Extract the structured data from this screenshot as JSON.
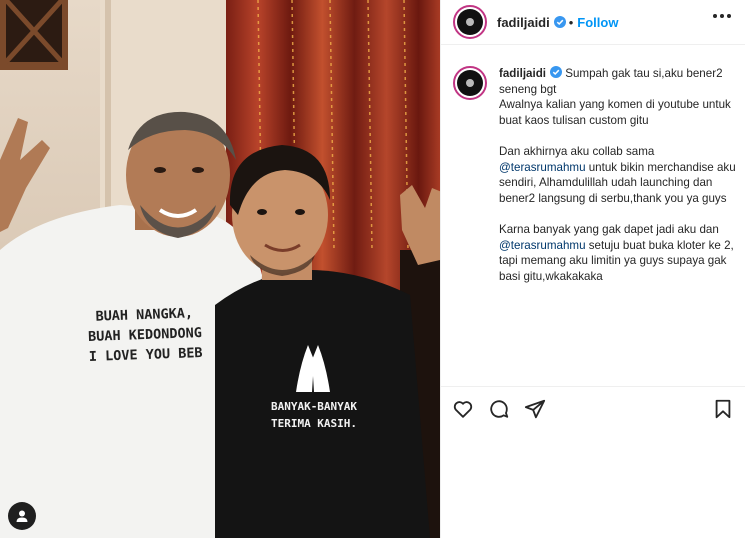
{
  "post": {
    "username": "fadiljaidi",
    "follow_label": "Follow",
    "separator": "•"
  },
  "caption": {
    "username": "fadiljaidi",
    "line1": " Sumpah gak tau si,aku bener2 seneng bgt",
    "line2": "Awalnya kalian yang komen di youtube untuk buat kaos tulisan custom gitu",
    "line3_pre": "Dan akhirnya aku collab sama ",
    "mention1": "@terasrumahmu",
    "line3_post": " untuk bikin merchandise aku sendiri, Alhamdulillah udah launching dan bener2 langsung di serbu,thank you ya guys",
    "line4_pre": "Karna banyak yang gak dapet jadi aku dan ",
    "mention2": "@terasrumahmu",
    "line4_post": " setuju buat buka kloter ke 2, tapi memang aku limitin ya guys supaya gak basi gitu,wkakakaka"
  },
  "photo": {
    "shirt_left_text": [
      "BUAH NANGKA,",
      "BUAH KEDONDONG",
      "I LOVE YOU BEB"
    ],
    "shirt_right_text": [
      "BANYAK-BANYAK",
      "TERIMA KASIH."
    ]
  },
  "icons": {
    "like": "heart-icon",
    "comment": "comment-icon",
    "share": "paper-plane-icon",
    "save": "bookmark-icon",
    "user_tag": "user-icon",
    "verified": "verified-badge-icon",
    "more": "more-options-icon"
  },
  "colors": {
    "follow": "#0095f6",
    "verified": "#3897f0",
    "mention": "#00376b",
    "story_ring": "#c13584"
  }
}
